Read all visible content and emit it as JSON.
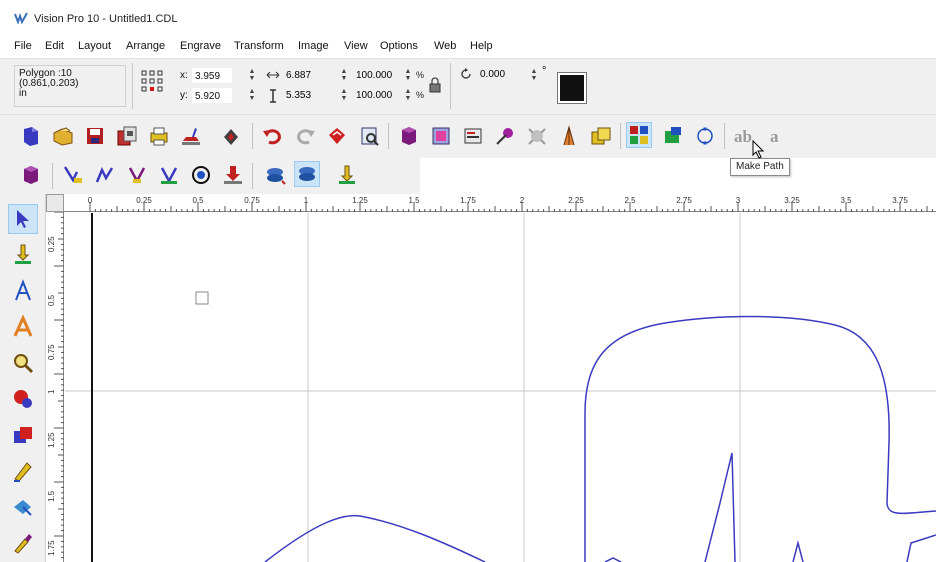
{
  "window": {
    "title": "Vision Pro 10 - Untitled1.CDL"
  },
  "menu": [
    "File",
    "Edit",
    "Layout",
    "Arrange",
    "Engrave",
    "Transform",
    "Image",
    "View",
    "Options",
    "Web",
    "Help"
  ],
  "properties": {
    "object_type": "Polygon :10",
    "object_coords": "(0.861,0.203)",
    "units": "in",
    "x_label": "x:",
    "x_value": "3.959",
    "y_label": "y:",
    "y_value": "5.920",
    "width_value": "6.887",
    "height_value": "5.353",
    "scale_x_value": "100.000",
    "scale_y_value": "100.000",
    "percent_symbol": "%",
    "rotation_value": "0.000",
    "degree_symbol": "°"
  },
  "toolbar1_icons": [
    "new-file-icon",
    "open-file-icon",
    "save-file-icon",
    "save-all-icon",
    "print-icon",
    "engrave-send-icon",
    "output-icon",
    "undo-icon",
    "redo-icon",
    "delete-icon",
    "preview-icon",
    "cube-icon",
    "import-image-icon",
    "properties-icon",
    "node-edit-icon",
    "tool-path-icon",
    "fill-icon",
    "array-icon",
    "make-path-icon",
    "create-icon",
    "circle-select-icon",
    "text-ab-icon",
    "text-a-icon"
  ],
  "toolbar2_icons": [
    "cube-small-icon",
    "tool-a-icon",
    "tool-b-icon",
    "tool-c-icon",
    "tool-d-icon",
    "target-icon",
    "download-icon",
    "layer-up-icon",
    "layer-down-icon",
    "engrave-tool-icon"
  ],
  "tools": [
    "pointer-tool-icon",
    "engrave-tool-icon",
    "text-tool-icon",
    "text-style-tool-icon",
    "zoom-tool-icon",
    "shape-tool-icon",
    "fill-tool-icon",
    "pen-tool-icon",
    "paint-tool-icon",
    "brush-tool-icon"
  ],
  "tooltip": {
    "text": "Make Path"
  },
  "text_buttons": {
    "ab": "ab",
    "a": "a"
  },
  "ruler": {
    "h_labels": [
      "0",
      "0.25",
      "0.5",
      "0.75",
      "1",
      "1.25",
      "1.5",
      "1.75",
      "2",
      "2.25",
      "2.5",
      "2.75",
      "3",
      "3.25",
      "3.5",
      "3.75"
    ],
    "v_labels": [
      "0.25",
      "0.5",
      "0.75",
      "1",
      "1.25",
      "1.5",
      "1.75"
    ]
  },
  "colors": {
    "path": "#3a3ac0",
    "grid": "#c8c8c8",
    "active_button": "#cce4f7"
  }
}
